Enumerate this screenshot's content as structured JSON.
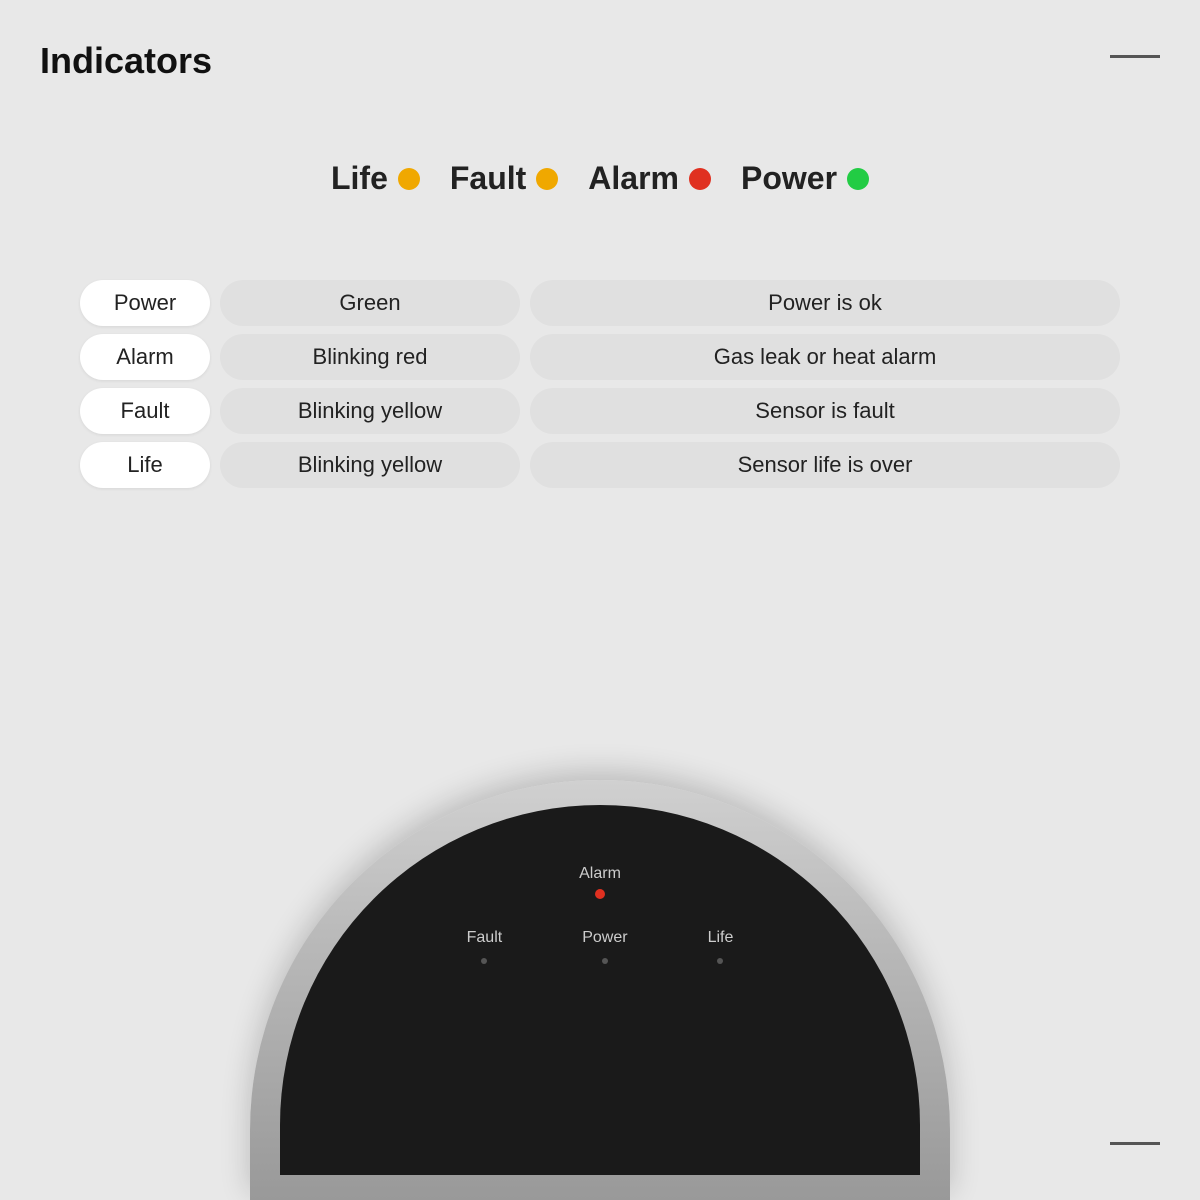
{
  "page": {
    "title": "Indicators",
    "bg_color": "#e8e8e8"
  },
  "legend": {
    "items": [
      {
        "label": "Life",
        "dot_color": "#f0a800"
      },
      {
        "label": "Fault",
        "dot_color": "#f0a800"
      },
      {
        "label": "Alarm",
        "dot_color": "#e03020"
      },
      {
        "label": "Power",
        "dot_color": "#22cc44"
      }
    ]
  },
  "table": {
    "rows": [
      {
        "label": "Power",
        "color": "Green",
        "desc": "Power is ok"
      },
      {
        "label": "Alarm",
        "color": "Blinking red",
        "desc": "Gas leak or heat alarm"
      },
      {
        "label": "Fault",
        "color": "Blinking yellow",
        "desc": "Sensor is fault"
      },
      {
        "label": "Life",
        "color": "Blinking yellow",
        "desc": "Sensor life is over"
      }
    ]
  },
  "device": {
    "alarm_label": "Alarm",
    "bottom_items": [
      {
        "label": "Fault"
      },
      {
        "label": "Power"
      },
      {
        "label": "Life"
      }
    ]
  }
}
